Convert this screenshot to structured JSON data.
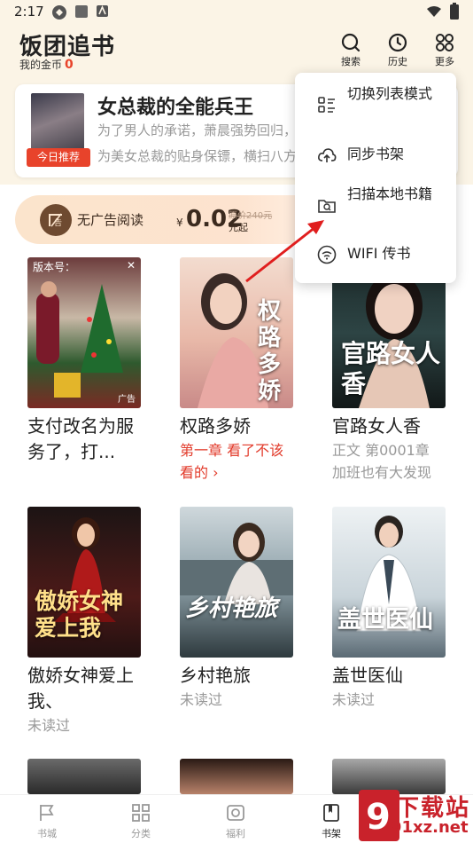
{
  "status": {
    "time": "2:17"
  },
  "header": {
    "title": "饭团追书",
    "coins_label": "我的金币",
    "coins_value": "0",
    "actions": [
      {
        "icon": "search-icon",
        "label": "搜索"
      },
      {
        "icon": "history-icon",
        "label": "历史"
      },
      {
        "icon": "more-icon",
        "label": "更多"
      }
    ]
  },
  "featured": {
    "title": "女总裁的全能兵王",
    "description": "为了男人的承诺，萧晨强势回归，成为美女总裁的贴身保镖，横扫八方",
    "tag": "今日推荐"
  },
  "ad_free": {
    "label": "无广告阅读",
    "currency": "¥",
    "price": "0.02",
    "original": "原价240元",
    "unit": "元起"
  },
  "books": [
    {
      "title": "支付改名为服务了，打...",
      "sub": "",
      "ad_badge": "版本号：",
      "ad_mark": "广告"
    },
    {
      "title": "权路多娇",
      "sub": "第一章 看了不该看的 ›",
      "cover_text": "权路多娇"
    },
    {
      "title": "官路女人香",
      "sub": "正文 第0001章 加班也有大发现",
      "cover_text": "官路女人香"
    },
    {
      "title": "傲娇女神爱上我、",
      "sub": "未读过",
      "cover_text": "傲娇女神爱上我"
    },
    {
      "title": "乡村艳旅",
      "sub": "未读过",
      "cover_text": "乡村艳旅"
    },
    {
      "title": "盖世医仙",
      "sub": "未读过",
      "cover_text": "盖世医仙"
    }
  ],
  "menu": {
    "items": [
      {
        "icon": "list-mode-icon",
        "label": "切换列表模式"
      },
      {
        "icon": "cloud-sync-icon",
        "label": "同步书架"
      },
      {
        "icon": "folder-search-icon",
        "label": "扫描本地书籍"
      },
      {
        "icon": "wifi-icon",
        "label": "WIFI 传书"
      }
    ]
  },
  "nav": {
    "items": [
      {
        "icon": "bookstore-icon",
        "label": "书城"
      },
      {
        "icon": "category-icon",
        "label": "分类"
      },
      {
        "icon": "welfare-icon",
        "label": "福利"
      },
      {
        "icon": "bookshelf-icon",
        "label": "书架"
      }
    ]
  },
  "watermark": {
    "big": "下载站",
    "small": "91xz.net"
  },
  "colors": {
    "accent": "#e8432b",
    "header_bg": "#fbf4e6",
    "watermark": "#c9222b"
  }
}
